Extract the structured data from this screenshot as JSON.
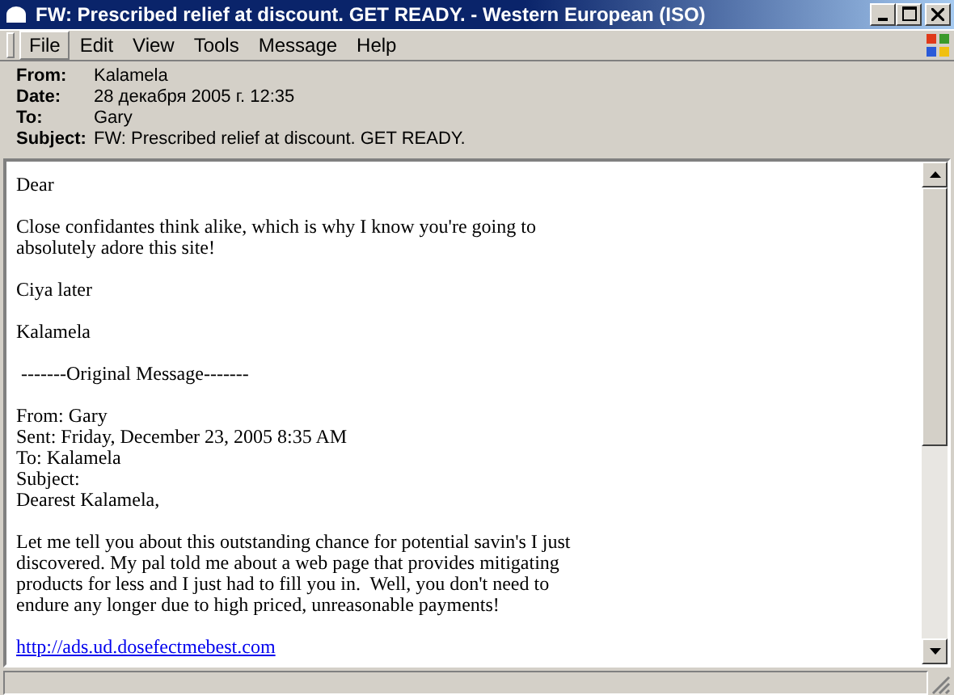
{
  "window": {
    "title": "FW: Prescribed relief at discount. GET READY. - Western European (ISO)"
  },
  "menu": [
    {
      "label": "File",
      "highlighted": true
    },
    {
      "label": "Edit",
      "highlighted": false
    },
    {
      "label": "View",
      "highlighted": false
    },
    {
      "label": "Tools",
      "highlighted": false
    },
    {
      "label": "Message",
      "highlighted": false
    },
    {
      "label": "Help",
      "highlighted": false
    }
  ],
  "headers": [
    {
      "label": "From:",
      "value": "Kalamela"
    },
    {
      "label": "Date:",
      "value": "28 декабря 2005 г. 12:35"
    },
    {
      "label": "To:",
      "value": "Gary"
    },
    {
      "label": "Subject:",
      "value": "FW: Prescribed relief at discount. GET READY."
    }
  ],
  "body": [
    {
      "kind": "text",
      "lines": [
        "Dear"
      ]
    },
    {
      "kind": "text",
      "lines": [
        "Close confidantes think alike, which is why I know you're going to",
        "absolutely adore this site!"
      ]
    },
    {
      "kind": "text",
      "lines": [
        "Ciya later"
      ]
    },
    {
      "kind": "text",
      "lines": [
        "Kalamela"
      ]
    },
    {
      "kind": "text",
      "lines": [
        " -------Original Message-------"
      ]
    },
    {
      "kind": "text",
      "lines": [
        "From: Gary",
        "Sent: Friday, December 23, 2005 8:35 AM",
        "To: Kalamela",
        "Subject:",
        "Dearest Kalamela,"
      ]
    },
    {
      "kind": "text",
      "lines": [
        "Let me tell you about this outstanding chance for potential savin's I just",
        "discovered. My pal told me about a web page that provides mitigating",
        "products for less and I just had to fill you in.  Well, you don't need to",
        "endure any longer due to high priced, unreasonable payments!"
      ]
    },
    {
      "kind": "link",
      "lines": [
        "http://ads.ud.dosefectmebest.com"
      ]
    }
  ]
}
